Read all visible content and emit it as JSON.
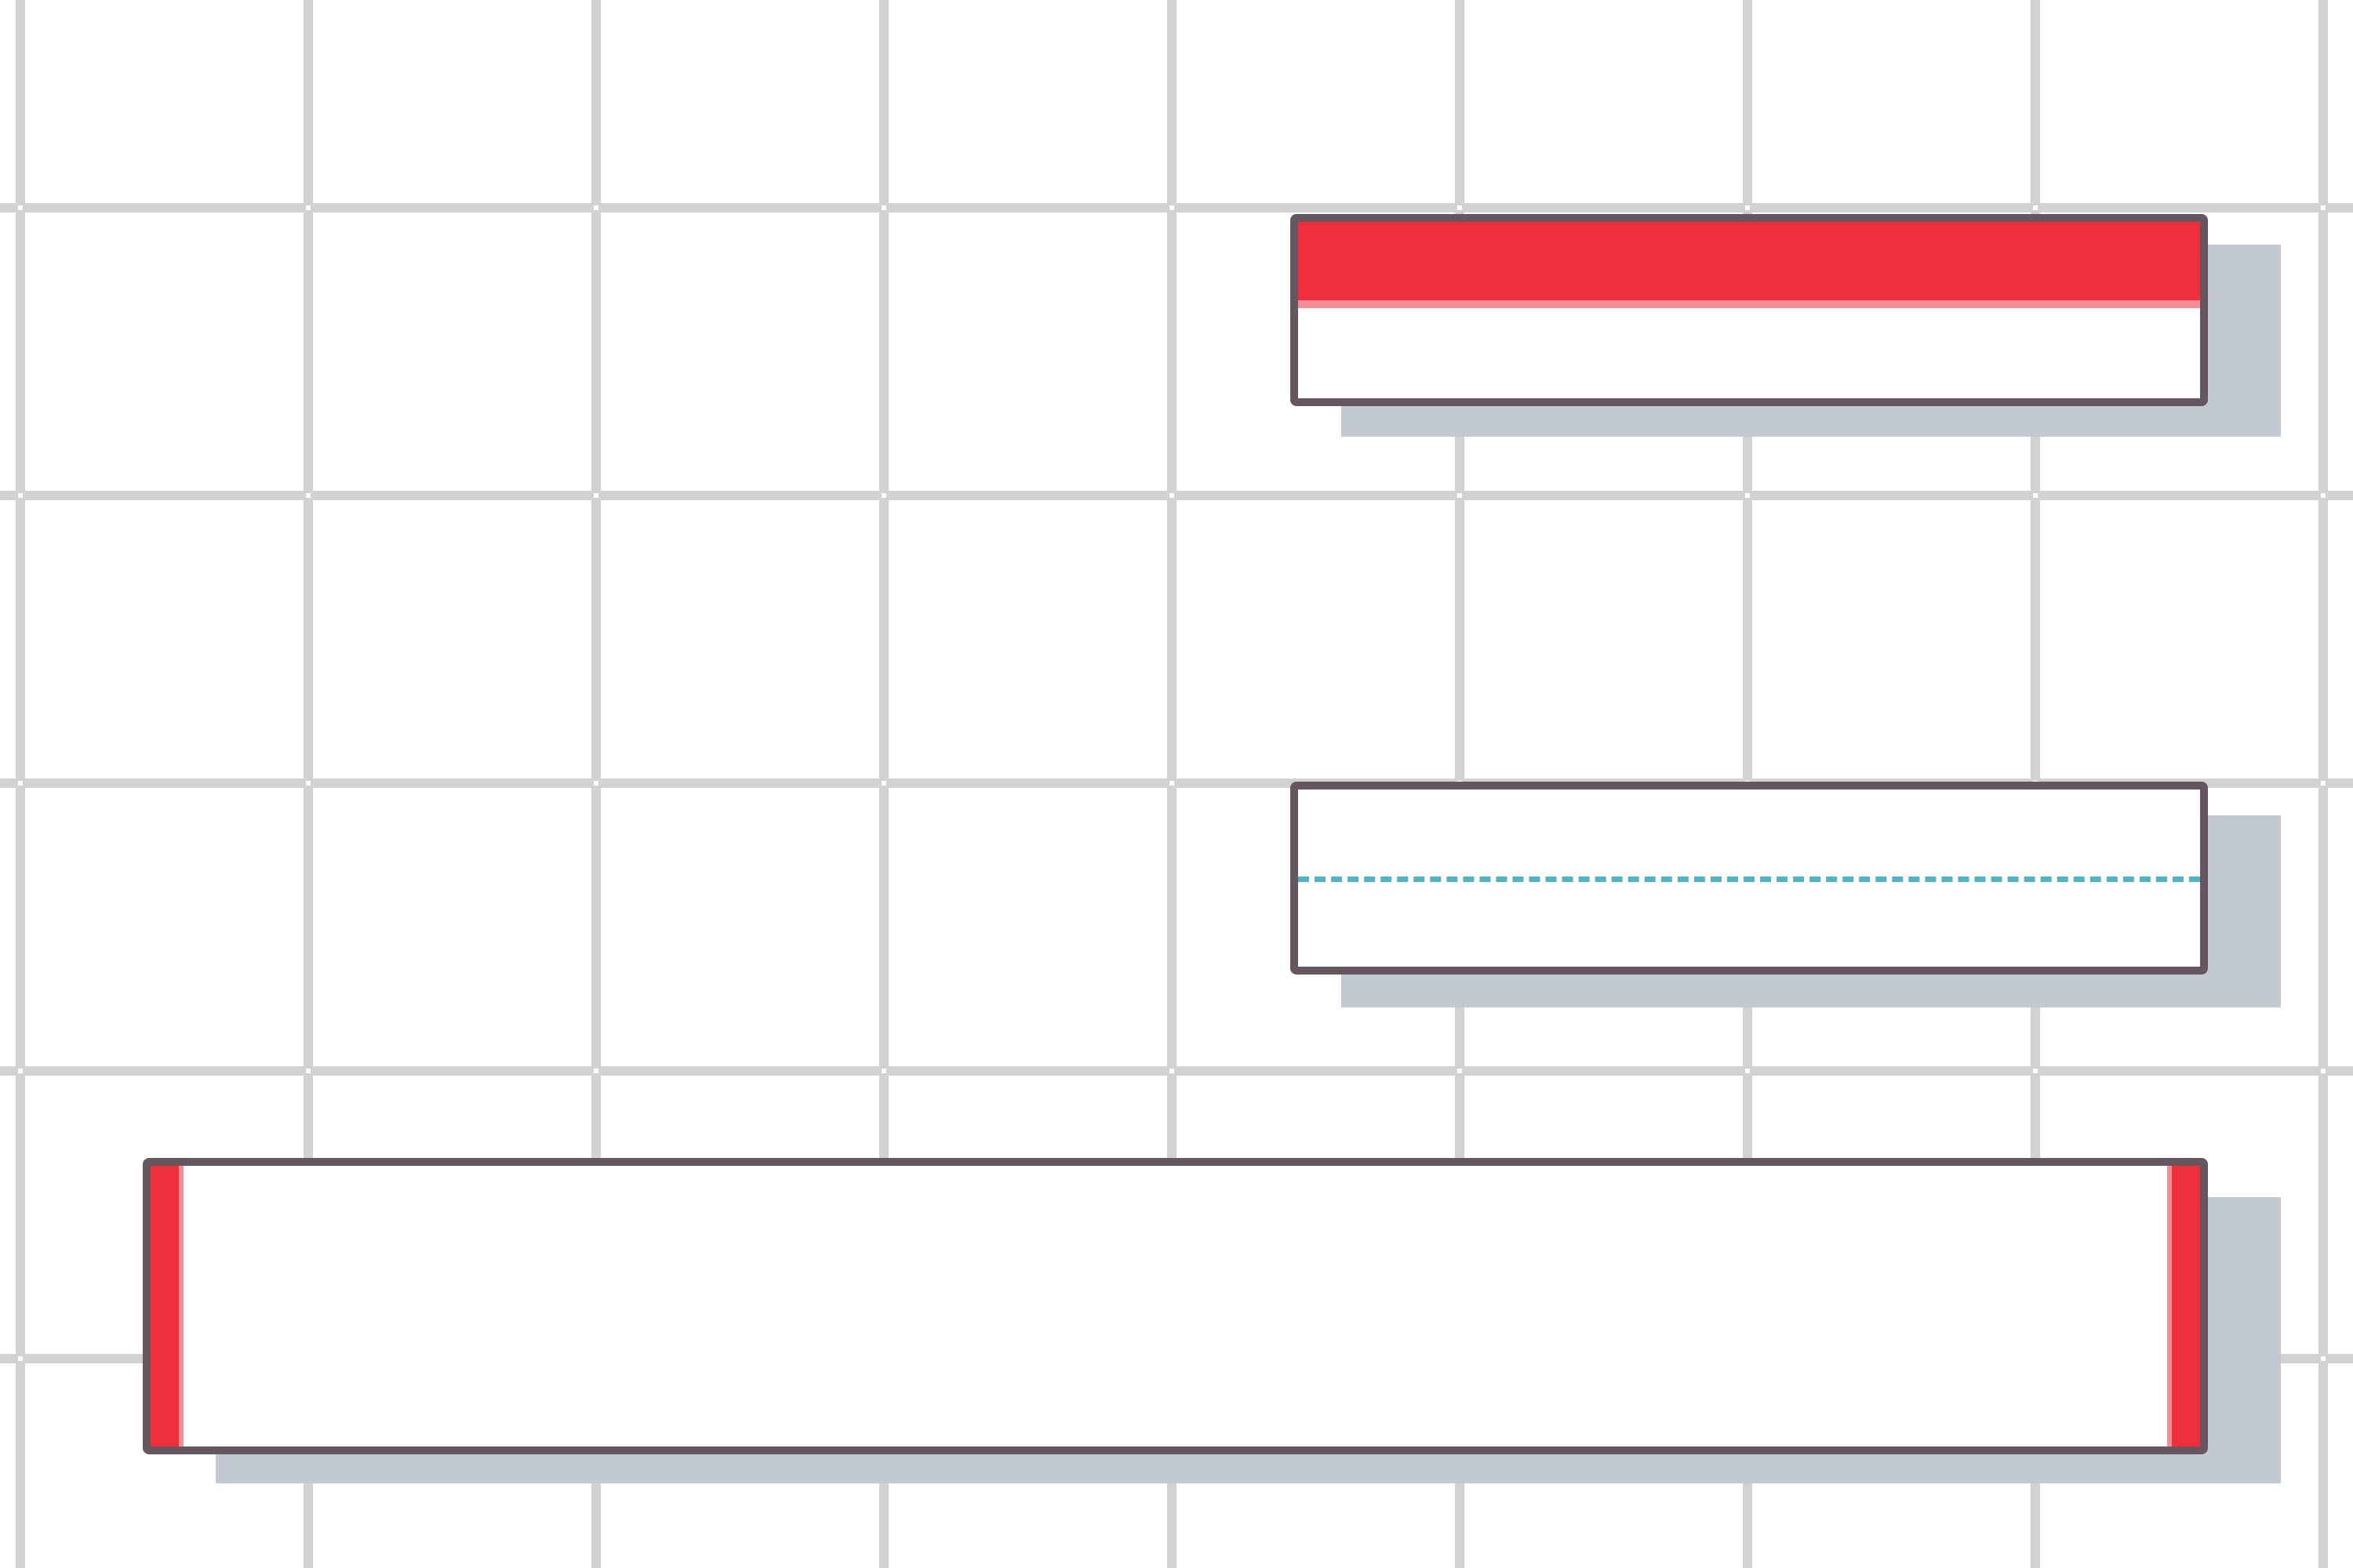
{
  "colors": {
    "background": "#ffffff",
    "grid_line": "#d2d2d2",
    "box_border": "#655660",
    "box_fill": "#ffffff",
    "shadow": "#c2c9d1",
    "accent_red": "#ef2f3b",
    "accent_red_light": "#f38e96",
    "dashed_line": "#52b3c4"
  },
  "panels": [
    {
      "name": "top-panel",
      "style": "red-top-band"
    },
    {
      "name": "middle-panel",
      "style": "dashed-center-line"
    },
    {
      "name": "bottom-panel",
      "style": "red-side-strips"
    }
  ]
}
